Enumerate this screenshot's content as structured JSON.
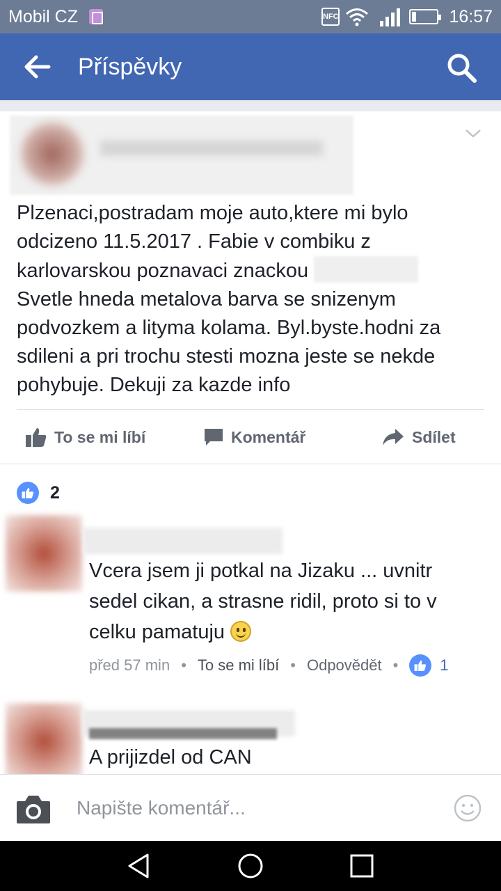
{
  "status_bar": {
    "carrier": "Mobil CZ",
    "nfc_label": "NFC",
    "time": "16:57",
    "icons": [
      "sim-icon",
      "nfc-icon",
      "wifi-icon",
      "signal-icon",
      "battery-icon"
    ],
    "battery_level": 0.15
  },
  "app_bar": {
    "title": "Příspěvky",
    "back_icon": "arrow-left-icon",
    "search_icon": "search-icon",
    "background": "#4267b2"
  },
  "post": {
    "text_line1": "Plzenaci,postradam moje auto,ktere mi bylo odcizeno 11.5.2017 .  Fabie v combiku z karlovarskou poznavaci znackou ",
    "text_line2": "Svetle hneda metalova barva se snizenym podvozkem a lityma kolama. Byl.byste.hodni za sdileni a pri trochu stesti mozna jeste se nekde pohybuje. Dekuji za kazde info",
    "actions": {
      "like": "To se mi líbí",
      "comment": "Komentář",
      "share": "Sdílet"
    },
    "reaction_count": "2"
  },
  "comments": [
    {
      "text": "Vcera jsem ji potkal na Jizaku ... uvnitr sedel cikan, a strasne ridil, proto si to v celku pamatuju",
      "emoji": "smiley-icon",
      "time": "před 57 min",
      "like_label": "To se mi líbí",
      "reply_label": "Odpovědět",
      "like_count": "1"
    },
    {
      "text": "A prijizdel od CAN"
    }
  ],
  "composer": {
    "placeholder": "Napište komentář..."
  },
  "colors": {
    "accent": "#4267b2",
    "like_blue": "#5890ff",
    "text": "#1d2129",
    "muted": "#90949c"
  }
}
